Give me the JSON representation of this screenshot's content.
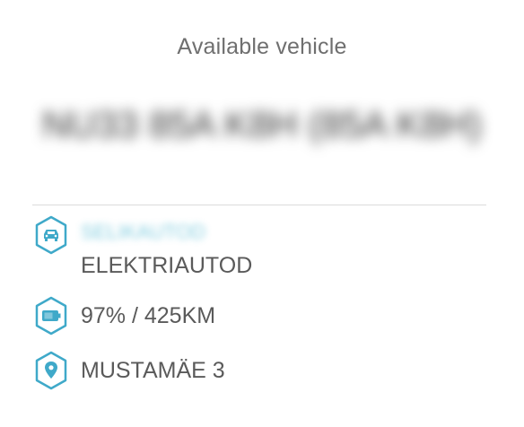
{
  "header": {
    "title": "Available vehicle"
  },
  "vehicle": {
    "name_redacted": "NU33 85A K8H (85A K8H)"
  },
  "details": {
    "category_redacted": "SELIKAUTOD",
    "category": "ELEKTRIAUTOD",
    "charge": "97% / 425KM",
    "location": "MUSTAMÄE 3"
  },
  "icons": {
    "car": "car-icon",
    "battery": "battery-icon",
    "location": "location-pin-icon"
  },
  "colors": {
    "accent": "#3fa9c9",
    "text": "#5a5a5a",
    "title": "#6f6f6f"
  }
}
